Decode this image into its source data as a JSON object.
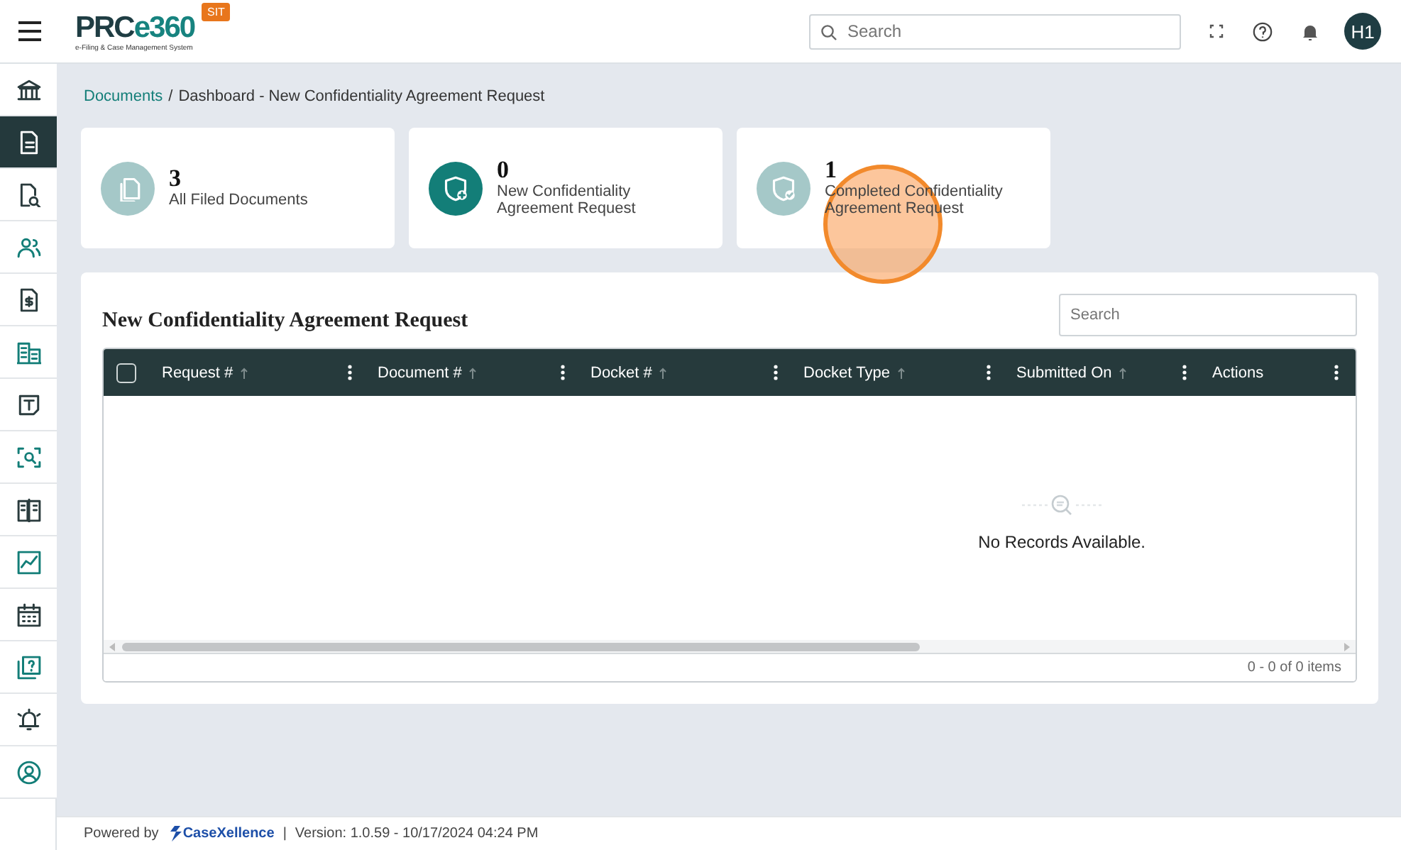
{
  "header": {
    "logo": {
      "prefix": "PRC",
      "suffix": "e360",
      "tagline": "e-Filing & Case Management System",
      "badge": "SIT"
    },
    "search": {
      "placeholder": "Search"
    },
    "avatar": "H1"
  },
  "sidebar": {
    "items": [
      {
        "kind": "bank",
        "selected": false
      },
      {
        "kind": "document",
        "selected": true
      },
      {
        "kind": "doc-search",
        "selected": false
      },
      {
        "kind": "users",
        "selected": false
      },
      {
        "kind": "invoice",
        "selected": false
      },
      {
        "kind": "building",
        "selected": false
      },
      {
        "kind": "text-box",
        "selected": false
      },
      {
        "kind": "scan",
        "selected": false
      },
      {
        "kind": "book",
        "selected": false
      },
      {
        "kind": "chart",
        "selected": false
      },
      {
        "kind": "calendar",
        "selected": false
      },
      {
        "kind": "help-doc",
        "selected": false
      },
      {
        "kind": "alarm",
        "selected": false
      },
      {
        "kind": "user-circle",
        "selected": false
      }
    ]
  },
  "breadcrumb": {
    "link": "Documents",
    "separator": "/",
    "current": "Dashboard - New Confidentiality Agreement Request"
  },
  "cards": [
    {
      "count": "3",
      "label": "All Filed Documents",
      "kind": "copy",
      "selected": false
    },
    {
      "count": "0",
      "label": "New Confidentiality Agreement Request",
      "kind": "shield-plus",
      "selected": true
    },
    {
      "count": "1",
      "label": "Completed Confidentiality Agreement Request",
      "kind": "shield-check",
      "selected": false
    }
  ],
  "panel": {
    "title": "New Confidentiality Agreement Request",
    "search": {
      "placeholder": "Search"
    },
    "table": {
      "select_all_checked": false,
      "columns": [
        {
          "label": "Request #",
          "sortable": true
        },
        {
          "label": "Document #",
          "sortable": true
        },
        {
          "label": "Docket #",
          "sortable": true
        },
        {
          "label": "Docket Type",
          "sortable": true
        },
        {
          "label": "Submitted On",
          "sortable": true
        },
        {
          "label": "Actions",
          "sortable": false
        }
      ],
      "empty_message": "No Records Available.",
      "pager": "0 - 0 of 0 items"
    }
  },
  "footer": {
    "powered_by": "Powered by",
    "brand": "CaseXellence",
    "separator": "|",
    "version": "Version: 1.0.59 - 10/17/2024 04:24 PM"
  }
}
